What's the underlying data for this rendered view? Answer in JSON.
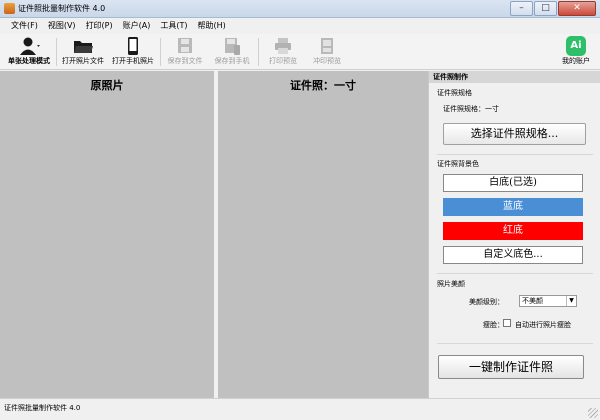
{
  "window": {
    "title": "证件照批量制作软件 4.0"
  },
  "menu": [
    "文件(F)",
    "视图(V)",
    "打印(P)",
    "账户(A)",
    "工具(T)",
    "帮助(H)"
  ],
  "toolbar": {
    "single_mode": "单张处理模式",
    "open_photo": "打开照片文件",
    "open_phone": "打开手机照片",
    "save_file": "保存到文件",
    "save_phone": "保存到手机",
    "print_preview": "打印预览",
    "wash_preview": "冲印预览",
    "my_account": "我的账户",
    "ai_badge": "Ai"
  },
  "panels": {
    "original": "原照片",
    "id_photo": "证件照：一寸"
  },
  "side": {
    "header": "证件照制作",
    "spec_section": "证件照规格",
    "spec_value": "证件照规格：一寸",
    "choose_spec": "选择证件照规格...",
    "bg_section": "证件照背景色",
    "bg_white": "白底(已选)",
    "bg_blue": "蓝底",
    "bg_red": "红底",
    "bg_custom": "自定义底色...",
    "beauty_section": "照片美颜",
    "beauty_level_label": "美颜级别：",
    "beauty_level_value": "不美颜",
    "skin_label": "瘦脸：",
    "auto_skin": "自动进行照片瘦脸",
    "make_button": "一键制作证件照"
  },
  "status": {
    "text": "证件照批量制作软件 4.0"
  },
  "colors": {
    "blue": "#4a8fd6",
    "red": "#ff0000",
    "canvas": "#c0c0c0",
    "accent_ai": "#2fbf6b"
  }
}
